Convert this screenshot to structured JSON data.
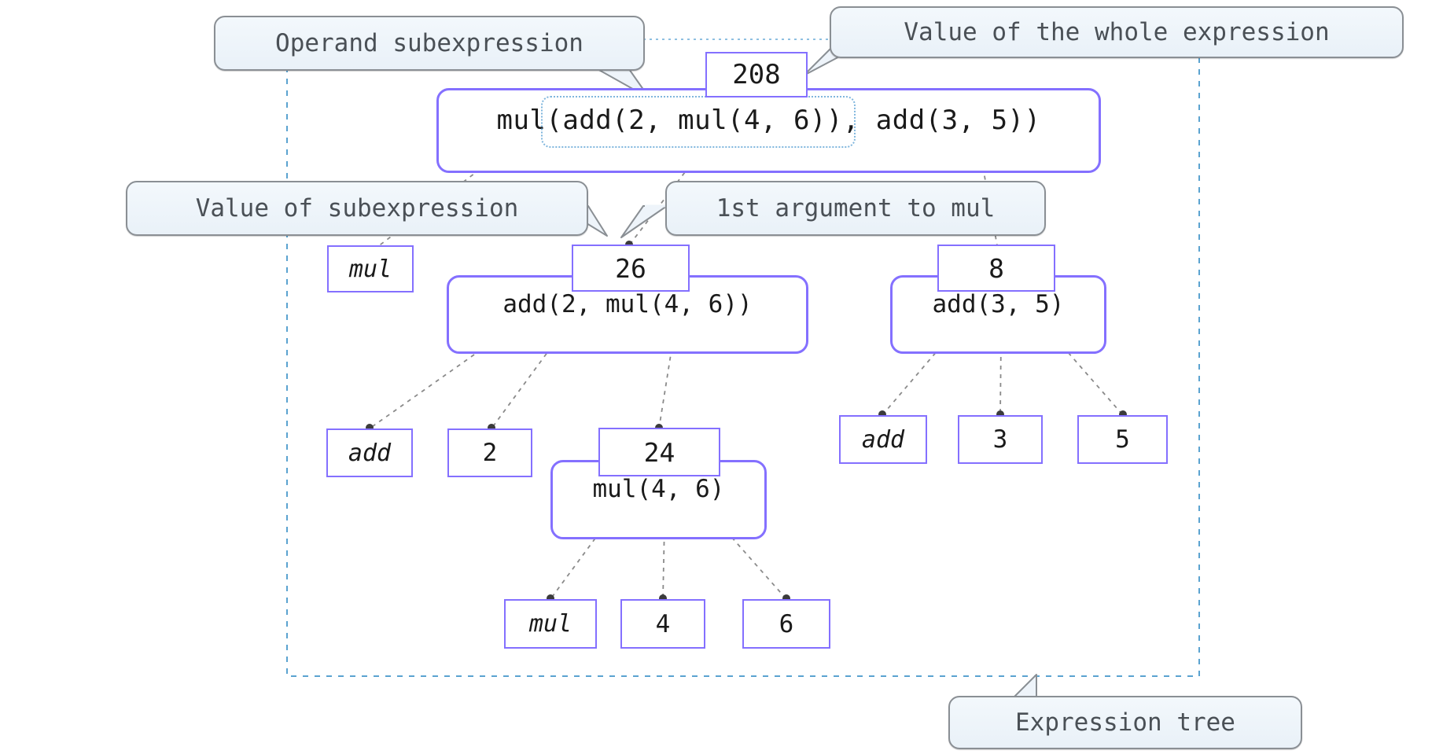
{
  "diagram": {
    "title_callout": "Expression tree",
    "colors": {
      "node_border": "#8470ff",
      "callout_bg": "#eef4fa",
      "callout_border": "#8a8f94",
      "callout_text": "#4a5056",
      "tree_boundary": "#5ba3d0",
      "highlight_dotted": "#7fb6dd",
      "connector": "#6a6a6a",
      "marker": "#7d7d7d"
    }
  },
  "callouts": [
    {
      "id": "operand-subexpression",
      "label": "Operand subexpression"
    },
    {
      "id": "value-of-whole-expression",
      "label": "Value of the whole expression"
    },
    {
      "id": "value-of-subexpression",
      "label": "Value of subexpression"
    },
    {
      "id": "first-argument-to-mul",
      "label": "1st argument to mul"
    },
    {
      "id": "expression-tree",
      "label": "Expression tree"
    }
  ],
  "nodes": {
    "root_expression": "mul(add(2, mul(4, 6)), add(3, 5))",
    "root_value": "208",
    "level2": {
      "operator": "mul",
      "left_value": "26",
      "left_expression": "add(2, mul(4, 6))",
      "right_value": "8",
      "right_expression": "add(3, 5)"
    },
    "level3": {
      "left_operator": "add",
      "left_operand": "2",
      "mid_value": "24",
      "mid_expression": "mul(4, 6)",
      "right_operator": "add",
      "right_operand_1": "3",
      "right_operand_2": "5"
    },
    "level4": {
      "operator": "mul",
      "operand_1": "4",
      "operand_2": "6"
    }
  },
  "chart_data": {
    "type": "tree",
    "title": "Expression tree",
    "root": {
      "expression": "mul(add(2, mul(4, 6)), add(3, 5))",
      "value": "208",
      "children": [
        {
          "expression": "mul",
          "value": null,
          "kind": "operator"
        },
        {
          "expression": "add(2, mul(4, 6))",
          "value": "26",
          "children": [
            {
              "expression": "add",
              "value": null,
              "kind": "operator"
            },
            {
              "expression": "2",
              "value": null,
              "kind": "literal"
            },
            {
              "expression": "mul(4, 6)",
              "value": "24",
              "children": [
                {
                  "expression": "mul",
                  "value": null,
                  "kind": "operator"
                },
                {
                  "expression": "4",
                  "value": null,
                  "kind": "literal"
                },
                {
                  "expression": "6",
                  "value": null,
                  "kind": "literal"
                }
              ]
            }
          ]
        },
        {
          "expression": "add(3, 5)",
          "value": "8",
          "children": [
            {
              "expression": "add",
              "value": null,
              "kind": "operator"
            },
            {
              "expression": "3",
              "value": null,
              "kind": "literal"
            },
            {
              "expression": "5",
              "value": null,
              "kind": "literal"
            }
          ]
        }
      ]
    },
    "annotations": [
      "Operand subexpression",
      "Value of the whole expression",
      "Value of subexpression",
      "1st argument to mul",
      "Expression tree"
    ]
  }
}
